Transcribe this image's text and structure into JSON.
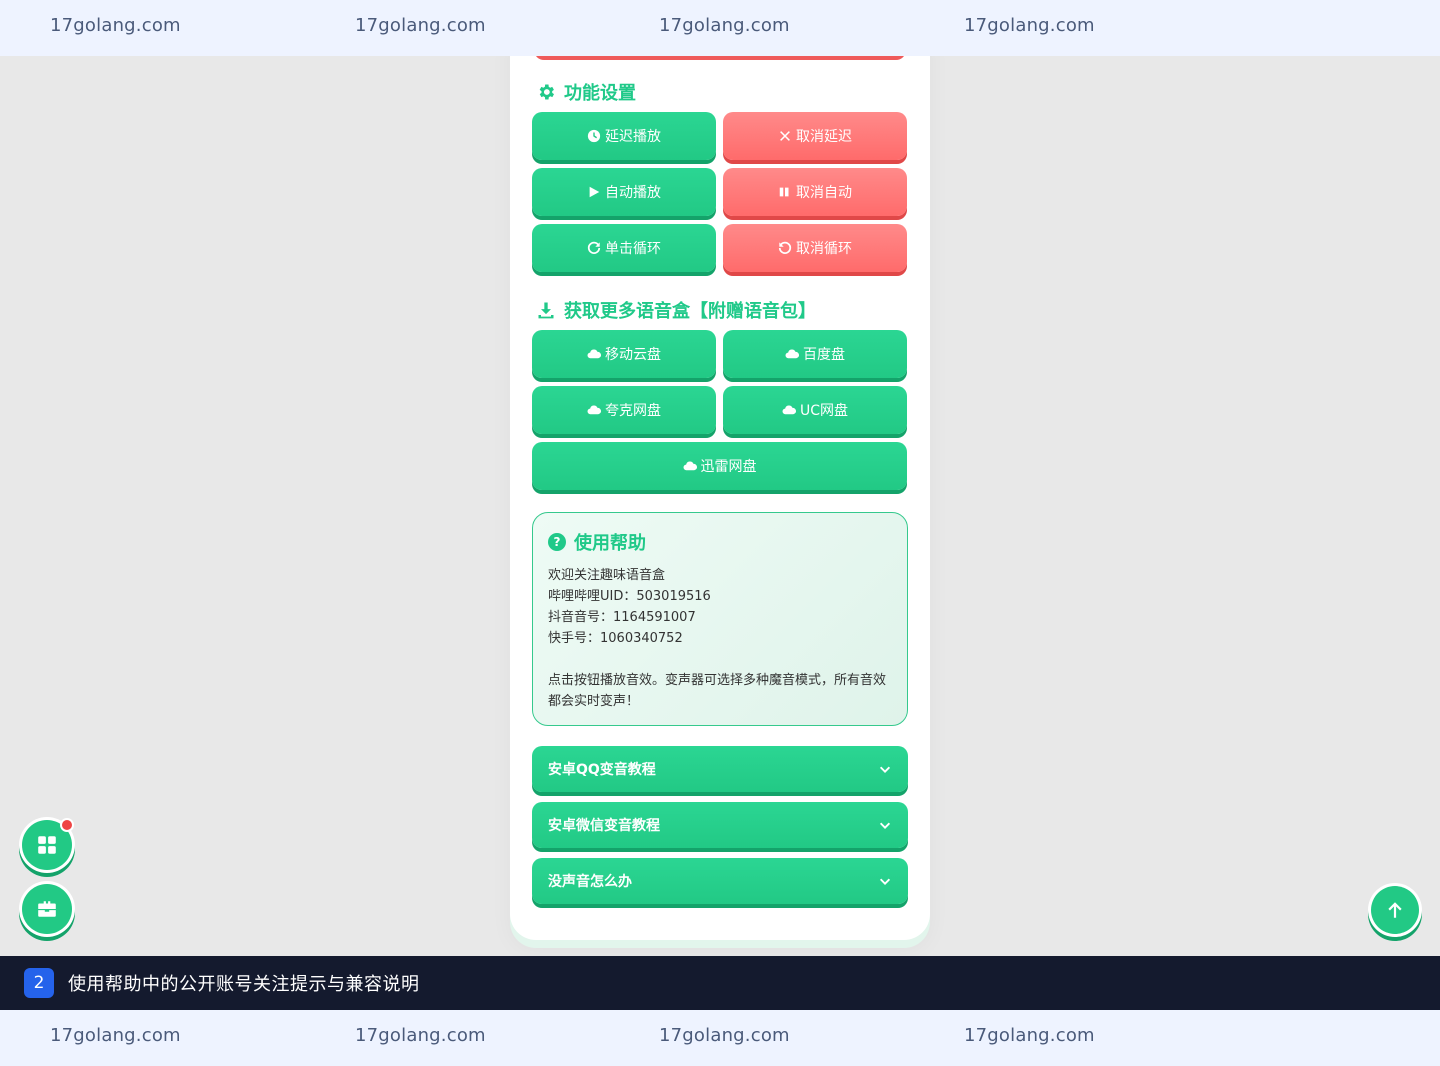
{
  "watermarks": {
    "text": "17golang.com",
    "top": [
      "17golang.com",
      "17golang.com",
      "17golang.com",
      "17golang.com"
    ],
    "bottom": [
      "17golang.com",
      "17golang.com",
      "17golang.com",
      "17golang.com"
    ]
  },
  "settings": {
    "title": "功能设置",
    "icon": "gear-icon",
    "buttons": [
      {
        "label": "延迟播放",
        "icon": "clock-icon",
        "color": "#22c985"
      },
      {
        "label": "取消延迟",
        "icon": "x-icon",
        "color": "#ff6b6b"
      },
      {
        "label": "自动播放",
        "icon": "play-icon",
        "color": "#22c985"
      },
      {
        "label": "取消自动",
        "icon": "pause-icon",
        "color": "#ff6b6b"
      },
      {
        "label": "单击循环",
        "icon": "redo-icon",
        "color": "#22c985"
      },
      {
        "label": "取消循环",
        "icon": "undo-icon",
        "color": "#ff6b6b"
      }
    ]
  },
  "downloads": {
    "title": "获取更多语音盒【附赠语音包】",
    "icon": "download-icon",
    "buttons": [
      {
        "label": "移动云盘",
        "icon": "cloud-icon"
      },
      {
        "label": "百度盘",
        "icon": "cloud-icon"
      },
      {
        "label": "夸克网盘",
        "icon": "cloud-icon"
      },
      {
        "label": "UC网盘",
        "icon": "cloud-icon"
      },
      {
        "label": "迅雷网盘",
        "icon": "cloud-icon"
      }
    ]
  },
  "help": {
    "title": "使用帮助",
    "lines": [
      "欢迎关注趣味语音盒",
      "哔哩哔哩UID：503019516",
      "抖音音号：1164591007",
      "快手号：1060340752",
      "点击按钮播放音效。变声器可选择多种魔音模式，所有音效",
      "都会实时变声！"
    ]
  },
  "accordions": [
    {
      "label": "安卓QQ变音教程",
      "icon": "chevron-down-icon"
    },
    {
      "label": "安卓微信变音教程",
      "icon": "chevron-down-icon"
    },
    {
      "label": "没声音怎么办",
      "icon": "chevron-down-icon"
    }
  ],
  "floating": {
    "left": [
      "grid-icon",
      "toolbox-icon"
    ],
    "right": "arrow-up-icon",
    "notification_dot": true
  },
  "caption": {
    "badge": "2",
    "text": "使用帮助中的公开账号关注提示与兼容说明"
  },
  "colors": {
    "accent_green": "#22c985",
    "accent_red": "#ff6b6b",
    "caption_bg": "#141a2e",
    "badge_blue": "#2563eb"
  }
}
